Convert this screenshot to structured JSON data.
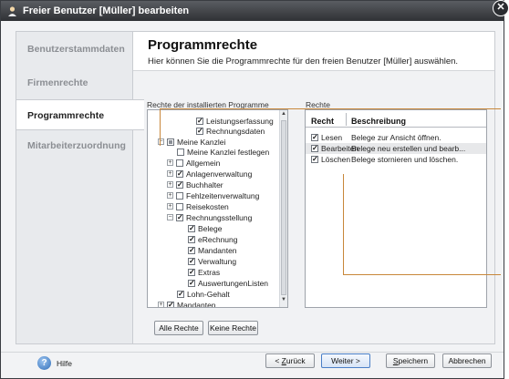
{
  "window": {
    "title": "Freier Benutzer [Müller] bearbeiten",
    "close_glyph": "✕"
  },
  "sidebar": {
    "items": [
      {
        "label": "Benutzerstammdaten"
      },
      {
        "label": "Firmenrechte"
      },
      {
        "label": "Programmrechte"
      },
      {
        "label": "Mitarbeiterzuordnung"
      }
    ]
  },
  "main": {
    "title": "Programmrechte",
    "subtitle": "Hier können Sie die Programmrechte für den freien Benutzer [Müller] auswählen.",
    "tree_group_label": "Rechte der installierten Programme",
    "rights_group_label": "Rechte"
  },
  "tree": {
    "rows": [
      {
        "label": "Leistungserfassung",
        "checked": true
      },
      {
        "label": "Rechnungsdaten",
        "checked": true
      },
      {
        "label": "Meine Kanzlei",
        "checked": "partial",
        "expander": "−"
      },
      {
        "label": "Meine Kanzlei festlegen",
        "checked": false
      },
      {
        "label": "Allgemein",
        "checked": false,
        "expander": "+"
      },
      {
        "label": "Anlagenverwaltung",
        "checked": true,
        "expander": "+"
      },
      {
        "label": "Buchhalter",
        "checked": true,
        "expander": "+"
      },
      {
        "label": "Fehlzeitenverwaltung",
        "checked": false,
        "expander": "+"
      },
      {
        "label": "Reisekosten",
        "checked": false,
        "expander": "+"
      },
      {
        "label": "Rechnungsstellung",
        "checked": true,
        "expander": "−"
      },
      {
        "label": "Belege",
        "checked": true
      },
      {
        "label": "eRechnung",
        "checked": true
      },
      {
        "label": "Mandanten",
        "checked": true
      },
      {
        "label": "Verwaltung",
        "checked": true
      },
      {
        "label": "Extras",
        "checked": true
      },
      {
        "label": "AuswertungenListen",
        "checked": true
      },
      {
        "label": "Lohn-Gehalt",
        "checked": true
      },
      {
        "label": "Mandanten",
        "checked": true,
        "expander": "+"
      }
    ]
  },
  "rights_table": {
    "columns": [
      "Recht",
      "Beschreibung"
    ],
    "rows": [
      {
        "right": "Lesen",
        "description": "Belege zur Ansicht öffnen.",
        "checked": true
      },
      {
        "right": "Bearbeiten",
        "description": "Belege neu erstellen und bearb...",
        "checked": true
      },
      {
        "right": "Löschen",
        "description": "Belege stornieren und löschen.",
        "checked": true
      }
    ]
  },
  "buttons": {
    "all_rights": "Alle Rechte",
    "no_rights": "Keine Rechte",
    "back_underlined": "Z",
    "back_rest": "urück",
    "back_prefix": "< ",
    "next": "Weiter >",
    "save_underlined": "S",
    "save_rest": "peichern",
    "cancel": "Abbrechen",
    "help": "Hilfe"
  },
  "colors": {
    "accent_callout": "#c8873a",
    "title_bar": "#2f3135",
    "primary_button_border": "#4a7fc7"
  }
}
